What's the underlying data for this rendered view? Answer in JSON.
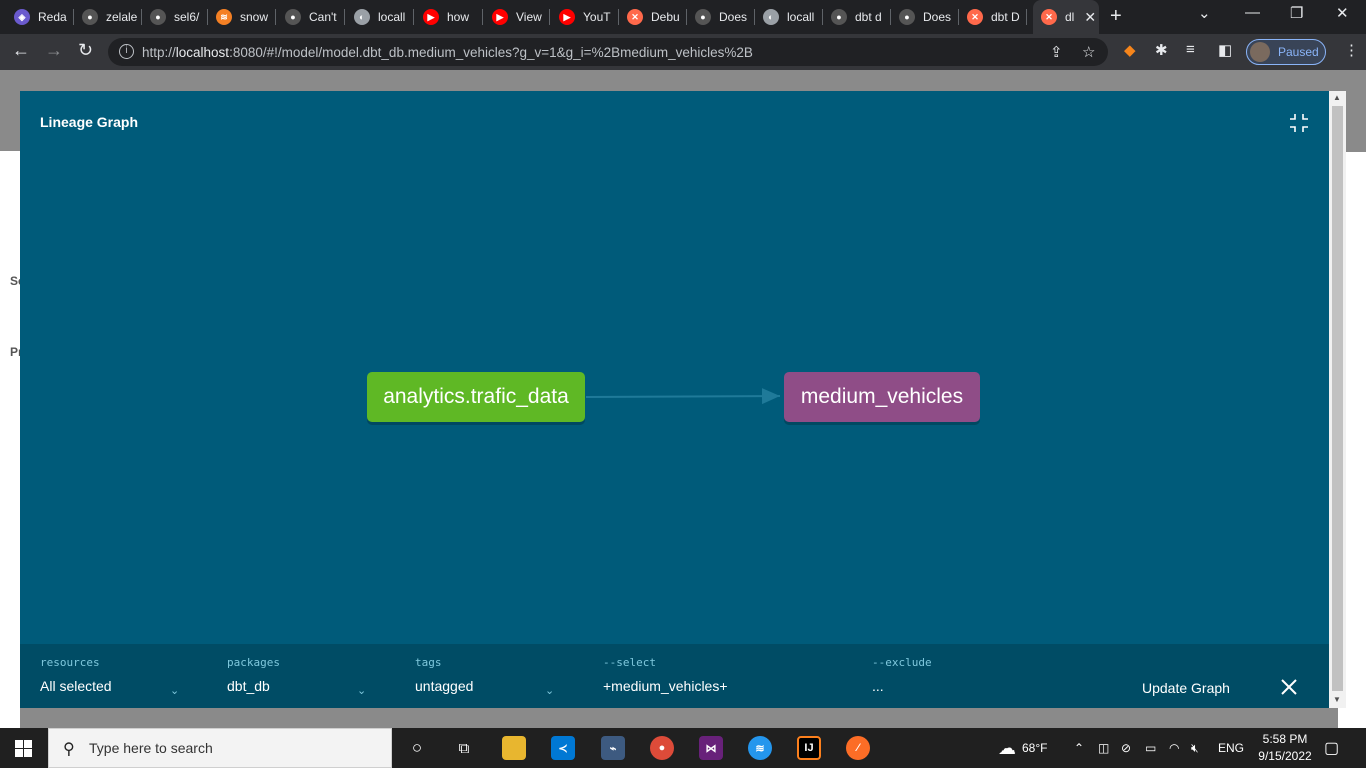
{
  "browser": {
    "tabs": [
      {
        "label": "Reda",
        "icon": "redash-icon",
        "color": "#6a5acd"
      },
      {
        "label": "zelale",
        "icon": "github-icon",
        "color": "#555555"
      },
      {
        "label": "sel6/",
        "icon": "github-icon",
        "color": "#555555"
      },
      {
        "label": "snow",
        "icon": "stackoverflow-icon",
        "color": "#f48024"
      },
      {
        "label": "Can't",
        "icon": "github-icon",
        "color": "#555555"
      },
      {
        "label": "locall",
        "icon": "globe-icon",
        "color": "#9aa0a6"
      },
      {
        "label": "how",
        "icon": "youtube-icon",
        "color": "#ff0000"
      },
      {
        "label": "View",
        "icon": "youtube-icon",
        "color": "#ff0000"
      },
      {
        "label": "YouT",
        "icon": "youtube-icon",
        "color": "#ff0000"
      },
      {
        "label": "Debu",
        "icon": "dbt-icon",
        "color": "#ff694b"
      },
      {
        "label": "Does",
        "icon": "github-icon",
        "color": "#555555"
      },
      {
        "label": "locall",
        "icon": "globe-icon",
        "color": "#9aa0a6"
      },
      {
        "label": "dbt d",
        "icon": "github-icon",
        "color": "#555555"
      },
      {
        "label": "Does",
        "icon": "github-icon",
        "color": "#555555"
      },
      {
        "label": "dbt D",
        "icon": "dbt-icon",
        "color": "#ff694b"
      },
      {
        "label": "dl",
        "icon": "dbt-icon",
        "color": "#ff694b",
        "active": true
      }
    ],
    "url_prefix": "http://",
    "url_host": "localhost",
    "url_rest": ":8080/#!/model/model.dbt_db.medium_vehicles?g_v=1&g_i=%2Bmedium_vehicles%2B",
    "profile_status": "Paused"
  },
  "page_behind": {
    "text1": "Se",
    "text2": "Pı"
  },
  "modal": {
    "title": "Lineage Graph",
    "nodes": [
      {
        "label": "analytics.trafic_data",
        "kind": "source",
        "color": "#5fb825"
      },
      {
        "label": "medium_vehicles",
        "kind": "model",
        "color": "#8f4d87"
      }
    ],
    "filters": {
      "resources": {
        "label": "resources",
        "value": "All selected"
      },
      "packages": {
        "label": "packages",
        "value": "dbt_db"
      },
      "tags": {
        "label": "tags",
        "value": "untagged"
      },
      "select": {
        "label": "--select",
        "value": "+medium_vehicles+"
      },
      "exclude": {
        "label": "--exclude",
        "value": "..."
      }
    },
    "update_button": "Update Graph"
  },
  "taskbar": {
    "search_placeholder": "Type here to search",
    "weather": "68°F",
    "language": "ENG",
    "time": "5:58 PM",
    "date": "9/15/2022"
  }
}
